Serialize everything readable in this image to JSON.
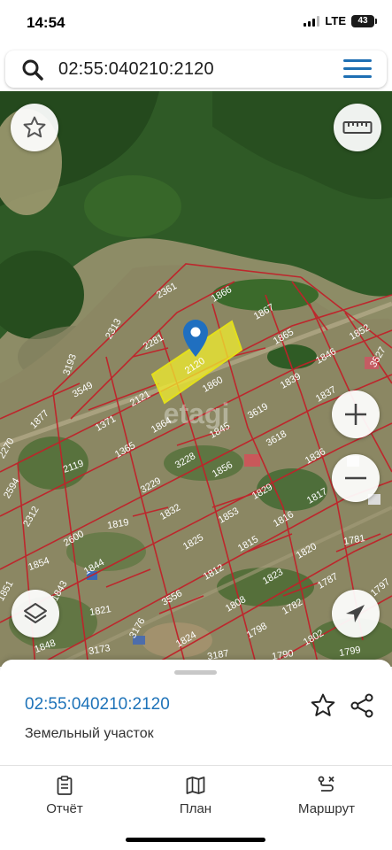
{
  "status": {
    "time": "14:54",
    "network": "LTE",
    "battery": "43"
  },
  "search": {
    "query": "02:55:040210:2120"
  },
  "map": {
    "selected_parcel": "2120",
    "parcels": [
      "2361",
      "1866",
      "2313",
      "2281",
      "1867",
      "1865",
      "1852",
      "3193",
      "3549",
      "2121",
      "1860",
      "1839",
      "1846",
      "3527",
      "1877",
      "1371",
      "1864",
      "1845",
      "3619",
      "1837",
      "2270",
      "1365",
      "3228",
      "3618",
      "1836",
      "2119",
      "3229",
      "1856",
      "1829",
      "1817",
      "2594",
      "1832",
      "1853",
      "1816",
      "2312",
      "1819",
      "2600",
      "1825",
      "1815",
      "1820",
      "1781",
      "1854",
      "1844",
      "1812",
      "1823",
      "1787",
      "1851",
      "1843",
      "3556",
      "1808",
      "1782",
      "1797",
      "1821",
      "3176",
      "1798",
      "1802",
      "1848",
      "3173",
      "1824",
      "3187",
      "1790",
      "1799"
    ],
    "watermark": "etagi"
  },
  "sheet": {
    "parcel_id": "02:55:040210:2120",
    "parcel_type": "Земельный участок"
  },
  "tabs": [
    {
      "label": "Отчёт",
      "icon": "report-icon"
    },
    {
      "label": "План",
      "icon": "map-plan-icon"
    },
    {
      "label": "Маршрут",
      "icon": "route-icon"
    }
  ],
  "colors": {
    "accent": "#1e73b9",
    "parcel_border": "#c0222a",
    "selected_fill": "#f2ee2e"
  }
}
